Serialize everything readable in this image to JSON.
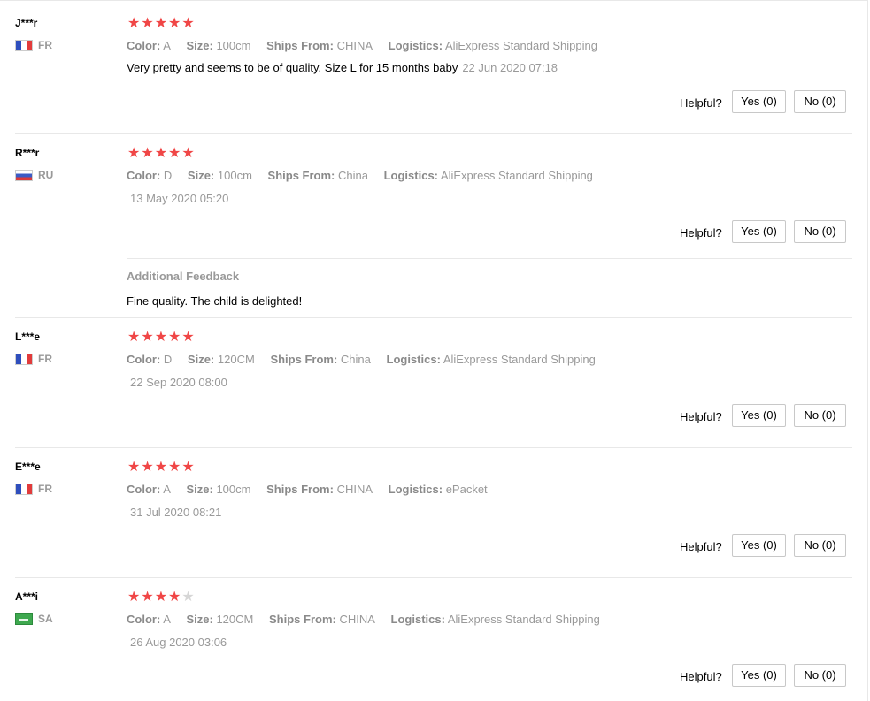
{
  "labels": {
    "color": "Color:",
    "size": "Size:",
    "ships_from": "Ships From:",
    "logistics": "Logistics:",
    "helpful": "Helpful?",
    "additional_feedback": "Additional Feedback"
  },
  "reviews": [
    {
      "user": "J***r",
      "country": "FR",
      "flag": "fr-flag-icon",
      "rating": 5,
      "color": "A",
      "size": "100cm",
      "ships_from": "CHINA",
      "logistics": "AliExpress Standard Shipping",
      "text": "Very pretty and seems to be of quality. Size L for 15 months baby",
      "date": "22 Jun 2020 07:18",
      "yes": "Yes (0)",
      "no": "No (0)"
    },
    {
      "user": "R***r",
      "country": "RU",
      "flag": "ru-flag-icon",
      "rating": 5,
      "color": "D",
      "size": "100cm",
      "ships_from": "China",
      "logistics": "AliExpress Standard Shipping",
      "date": "13 May 2020 05:20",
      "yes": "Yes (0)",
      "no": "No (0)",
      "additional_text": "Fine quality. The child is delighted!"
    },
    {
      "user": "L***e",
      "country": "FR",
      "flag": "fr-flag-icon",
      "rating": 5,
      "color": "D",
      "size": "120CM",
      "ships_from": "China",
      "logistics": "AliExpress Standard Shipping",
      "date": "22 Sep 2020 08:00",
      "yes": "Yes (0)",
      "no": "No (0)"
    },
    {
      "user": "E***e",
      "country": "FR",
      "flag": "fr-flag-icon",
      "rating": 5,
      "color": "A",
      "size": "100cm",
      "ships_from": "CHINA",
      "logistics": "ePacket",
      "date": "31 Jul 2020 08:21",
      "yes": "Yes (0)",
      "no": "No (0)"
    },
    {
      "user": "A***i",
      "country": "SA",
      "flag": "sa-flag-icon",
      "rating": 4,
      "color": "A",
      "size": "120CM",
      "ships_from": "CHINA",
      "logistics": "AliExpress Standard Shipping",
      "date": "26 Aug 2020 03:06",
      "yes": "Yes (0)",
      "no": "No (0)"
    }
  ],
  "colors": {
    "star_on": "#f04646",
    "star_off": "#d6d6d6",
    "muted_text": "#999999",
    "divider": "#e8e8e8"
  }
}
